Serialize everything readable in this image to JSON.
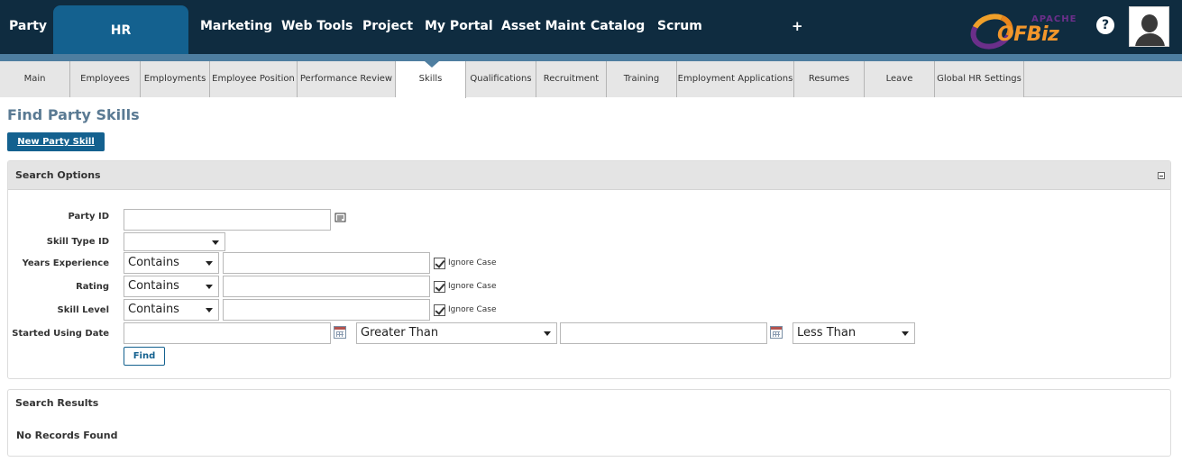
{
  "topnav": {
    "items": [
      "Party",
      "HR",
      "Marketing",
      "Web Tools",
      "Project",
      "My Portal",
      "Asset Maint",
      "Catalog",
      "Scrum"
    ],
    "active": "HR",
    "plus": "+",
    "help": "?",
    "logo_apache": "APACHE",
    "logo_ofbiz": "OFBiz"
  },
  "tabs": [
    {
      "label": "Main"
    },
    {
      "label": "Employees"
    },
    {
      "label": "Employments"
    },
    {
      "label": "Employee Position"
    },
    {
      "label": "Performance Review"
    },
    {
      "label": "Skills"
    },
    {
      "label": "Qualifications"
    },
    {
      "label": "Recruitment"
    },
    {
      "label": "Training"
    },
    {
      "label": "Employment Applications"
    },
    {
      "label": "Resumes"
    },
    {
      "label": "Leave"
    },
    {
      "label": "Global HR Settings"
    }
  ],
  "active_tab": "Skills",
  "page": {
    "title": "Find Party Skills",
    "new_button": "New Party Skill"
  },
  "search_options": {
    "title": "Search Options",
    "fields": {
      "party_id": {
        "label": "Party ID",
        "value": ""
      },
      "skill_type_id": {
        "label": "Skill Type ID",
        "value": ""
      },
      "years_experience": {
        "label": "Years Experience",
        "operator": "Contains",
        "value": "",
        "ignore_case": true,
        "ignore_case_label": "Ignore Case"
      },
      "rating": {
        "label": "Rating",
        "operator": "Contains",
        "value": "",
        "ignore_case": true,
        "ignore_case_label": "Ignore Case"
      },
      "skill_level": {
        "label": "Skill Level",
        "operator": "Contains",
        "value": "",
        "ignore_case": true,
        "ignore_case_label": "Ignore Case"
      },
      "started_using_date": {
        "label": "Started Using Date",
        "from_value": "",
        "from_operator": "Greater Than",
        "thru_value": "",
        "thru_operator": "Less Than"
      }
    },
    "find_button": "Find"
  },
  "search_results": {
    "title": "Search Results",
    "empty_message": "No Records Found"
  },
  "colors": {
    "topbar": "#0f2c40",
    "active_menu": "#14618f",
    "strip": "#4e7ea0",
    "title": "#5a7a93"
  }
}
